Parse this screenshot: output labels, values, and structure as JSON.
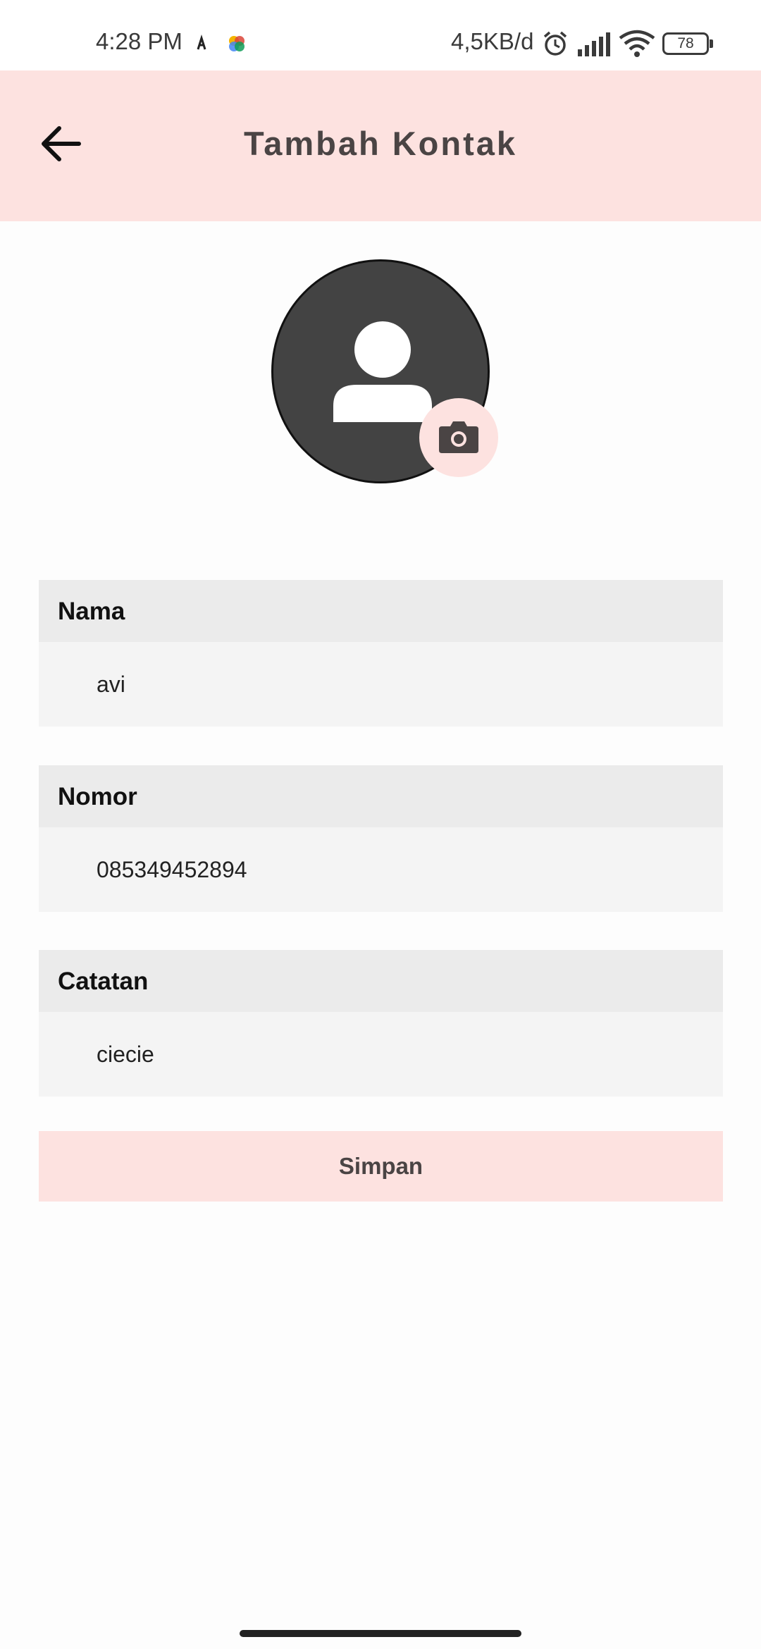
{
  "status_bar": {
    "time": "4:28 PM",
    "network_speed": "4,5KB/d",
    "battery_level": "78",
    "icons": [
      "notification-app-icon",
      "notification-app-icon",
      "alarm-icon",
      "cellular-signal-icon",
      "wifi-icon",
      "battery-icon"
    ]
  },
  "app_bar": {
    "title": "Tambah Kontak",
    "back_icon": "arrow-left-icon"
  },
  "avatar": {
    "placeholder_icon": "person-icon",
    "camera_icon": "camera-icon"
  },
  "form": {
    "nama": {
      "label": "Nama",
      "value": "avi"
    },
    "nomor": {
      "label": "Nomor",
      "value": "085349452894"
    },
    "catatan": {
      "label": "Catatan",
      "value": "ciecie"
    }
  },
  "actions": {
    "save_label": "Simpan"
  },
  "colors": {
    "accent_pink": "#fde2e0",
    "title_text": "#4a4444",
    "avatar_bg": "#434343",
    "label_bg": "#ebebeb",
    "input_bg": "#f4f4f4"
  }
}
